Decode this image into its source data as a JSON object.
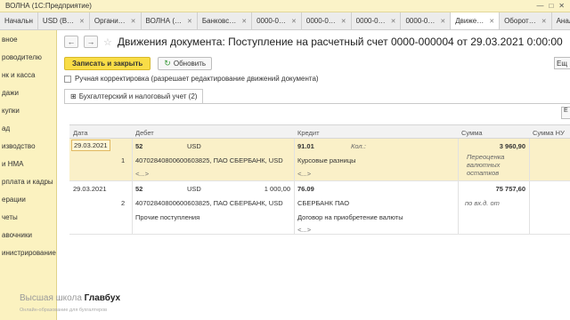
{
  "window": {
    "title": "ВОЛНА  (1С:Предприятие)",
    "controls": [
      "—",
      "□",
      "✕"
    ]
  },
  "tabs": [
    {
      "label": "Начальн",
      "closable": false
    },
    {
      "label": "USD (В…",
      "closable": true
    },
    {
      "label": "Органи…",
      "closable": true
    },
    {
      "label": "ВОЛНА (…",
      "closable": true
    },
    {
      "label": "Банковс…",
      "closable": true
    },
    {
      "label": "0000-0…",
      "closable": true
    },
    {
      "label": "0000-0…",
      "closable": true
    },
    {
      "label": "0000-0…",
      "closable": true
    },
    {
      "label": "0000-0…",
      "closable": true
    },
    {
      "label": "Движе…",
      "closable": true
    },
    {
      "label": "Оборот…",
      "closable": true
    },
    {
      "label": "Анализ…",
      "closable": true
    }
  ],
  "sidebar": {
    "items": [
      "вное",
      "роводителю",
      "нк и касса",
      "дажи",
      "купки",
      "ад",
      "изводство",
      "и НМА",
      "рплата и кадры",
      "ерации",
      "четы",
      "авочники",
      "инистрирование"
    ]
  },
  "header": {
    "title": "Движения документа: Поступление на расчетный счет 0000-000004 от 29.03.2021 0:00:00",
    "back": "←",
    "forward": "→",
    "star": "☆"
  },
  "toolbar": {
    "save_close": "Записать и закрыть",
    "refresh": "Обновить",
    "more": "Ещ"
  },
  "manual_correction": "Ручная корректировка (разрешает редактирование движений документа)",
  "subtab": {
    "label": "Бухгалтерский и налоговый учет (2)",
    "icon": "⊞"
  },
  "table": {
    "headers": {
      "date": "Дата",
      "debit": "Дебет",
      "credit": "Кредит",
      "sum": "Сумма",
      "sum_nu": "Сумма НУ Д"
    },
    "rows": [
      {
        "date": "29.03.2021",
        "num": "1",
        "debit_account": "52",
        "debit_currency": "USD",
        "debit_amount": "",
        "debit_sub1": "40702840800600603825, ПАО СБЕРБАНК, USD",
        "debit_sub2": "<...>",
        "credit_account": "91.01",
        "credit_qty": "Кол.:",
        "credit_sub1": "Курсовые разницы",
        "credit_sub2": "<...>",
        "sum": "3 960,90",
        "sum_note": "Переоценка валютных остатков"
      },
      {
        "date": "29.03.2021",
        "num": "2",
        "debit_account": "52",
        "debit_currency": "USD",
        "debit_amount": "1 000,00",
        "debit_sub1": "40702840800600603825, ПАО СБЕРБАНК, USD",
        "debit_sub2": "Прочие поступления",
        "credit_account": "76.09",
        "credit_qty": "",
        "credit_sub1": "СБЕРБАНК ПАО",
        "credit_sub2": "Договор на приобретение валюты",
        "credit_sub3": "<...>",
        "sum": "75 757,60",
        "sum_note": "по вх.д.   от"
      }
    ]
  },
  "watermark": {
    "prefix": "Высшая школа ",
    "brand": "Главбух",
    "sub": "Онлайн-образование для бухгалтеров"
  },
  "colors": {
    "sidebar": "#fbf2c0",
    "primary_button": "#f9dd47",
    "selected_row": "#faf0c8"
  }
}
